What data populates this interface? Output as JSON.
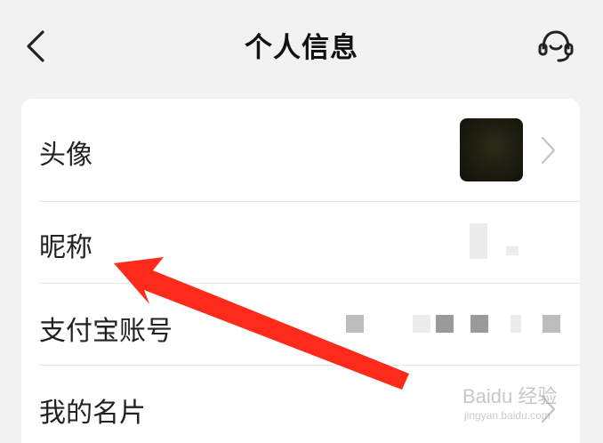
{
  "header": {
    "title": "个人信息",
    "back_icon": "chevron-left-icon",
    "support_icon": "headset-icon"
  },
  "rows": [
    {
      "label": "头像",
      "value_type": "avatar-image"
    },
    {
      "label": "昵称",
      "value_type": "redacted-text"
    },
    {
      "label": "支付宝账号",
      "value_type": "redacted-text"
    },
    {
      "label": "我的名片",
      "value_type": "chevron"
    }
  ],
  "annotation": {
    "arrow_color": "#ff2a1a",
    "points_to": "昵称"
  },
  "watermark": {
    "brand": "Baidu 经验",
    "url": "jingyan.baidu.com"
  },
  "colors": {
    "background": "#f2f2f2",
    "card": "#ffffff",
    "text": "#222222",
    "divider": "#e6e6e6",
    "chevron": "#c4c4c4"
  }
}
